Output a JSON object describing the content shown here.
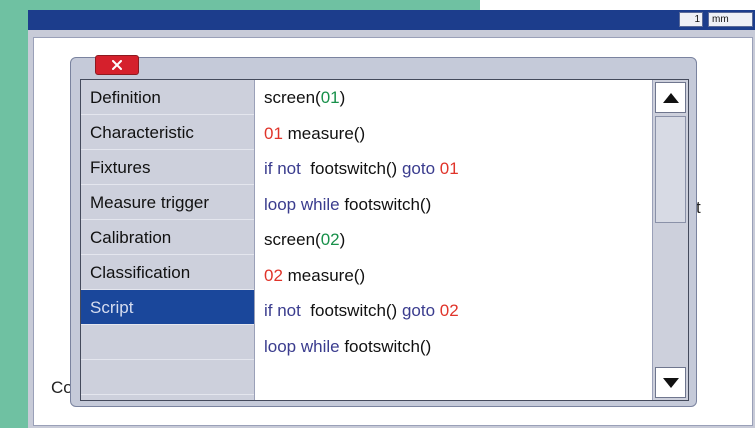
{
  "toolbar": {
    "unit_value": "1",
    "unit_label": "mm"
  },
  "background_fragments": {
    "left": "Co",
    "right": "t"
  },
  "dialog": {
    "categories": [
      {
        "label": "Definition"
      },
      {
        "label": "Characteristic"
      },
      {
        "label": "Fixtures"
      },
      {
        "label": "Measure trigger"
      },
      {
        "label": "Calibration"
      },
      {
        "label": "Classification"
      },
      {
        "label": "Script",
        "selected": true
      }
    ],
    "script_lines": [
      [
        {
          "t": "screen(",
          "k": "fn"
        },
        {
          "t": "01",
          "k": "arg"
        },
        {
          "t": ")",
          "k": "fn"
        }
      ],
      [
        {
          "t": "01",
          "k": "num"
        },
        {
          "t": " measure()",
          "k": "fn"
        }
      ],
      [
        {
          "t": "if not",
          "k": "kw"
        },
        {
          "t": "  footswitch() ",
          "k": "fn"
        },
        {
          "t": "goto",
          "k": "kw"
        },
        {
          "t": " 01",
          "k": "num"
        }
      ],
      [
        {
          "t": "loop while",
          "k": "kw"
        },
        {
          "t": " footswitch()",
          "k": "fn"
        }
      ],
      [
        {
          "t": "screen(",
          "k": "fn"
        },
        {
          "t": "02",
          "k": "arg"
        },
        {
          "t": ")",
          "k": "fn"
        }
      ],
      [
        {
          "t": "02",
          "k": "num"
        },
        {
          "t": " measure()",
          "k": "fn"
        }
      ],
      [
        {
          "t": "if not",
          "k": "kw"
        },
        {
          "t": "  footswitch() ",
          "k": "fn"
        },
        {
          "t": "goto",
          "k": "kw"
        },
        {
          "t": " 02",
          "k": "num"
        }
      ],
      [
        {
          "t": "loop while",
          "k": "kw"
        },
        {
          "t": " footswitch()",
          "k": "fn"
        }
      ]
    ]
  },
  "icons": {
    "close": "close-icon",
    "scroll_up": "arrow-up-icon",
    "scroll_down": "arrow-down-icon"
  },
  "colors": {
    "title_bar": "#1c3d8c",
    "selected": "#1a479b",
    "close_button": "#d5202c",
    "keyword": "#3a3c8e",
    "number": "#e0342a",
    "argument": "#18904a"
  }
}
